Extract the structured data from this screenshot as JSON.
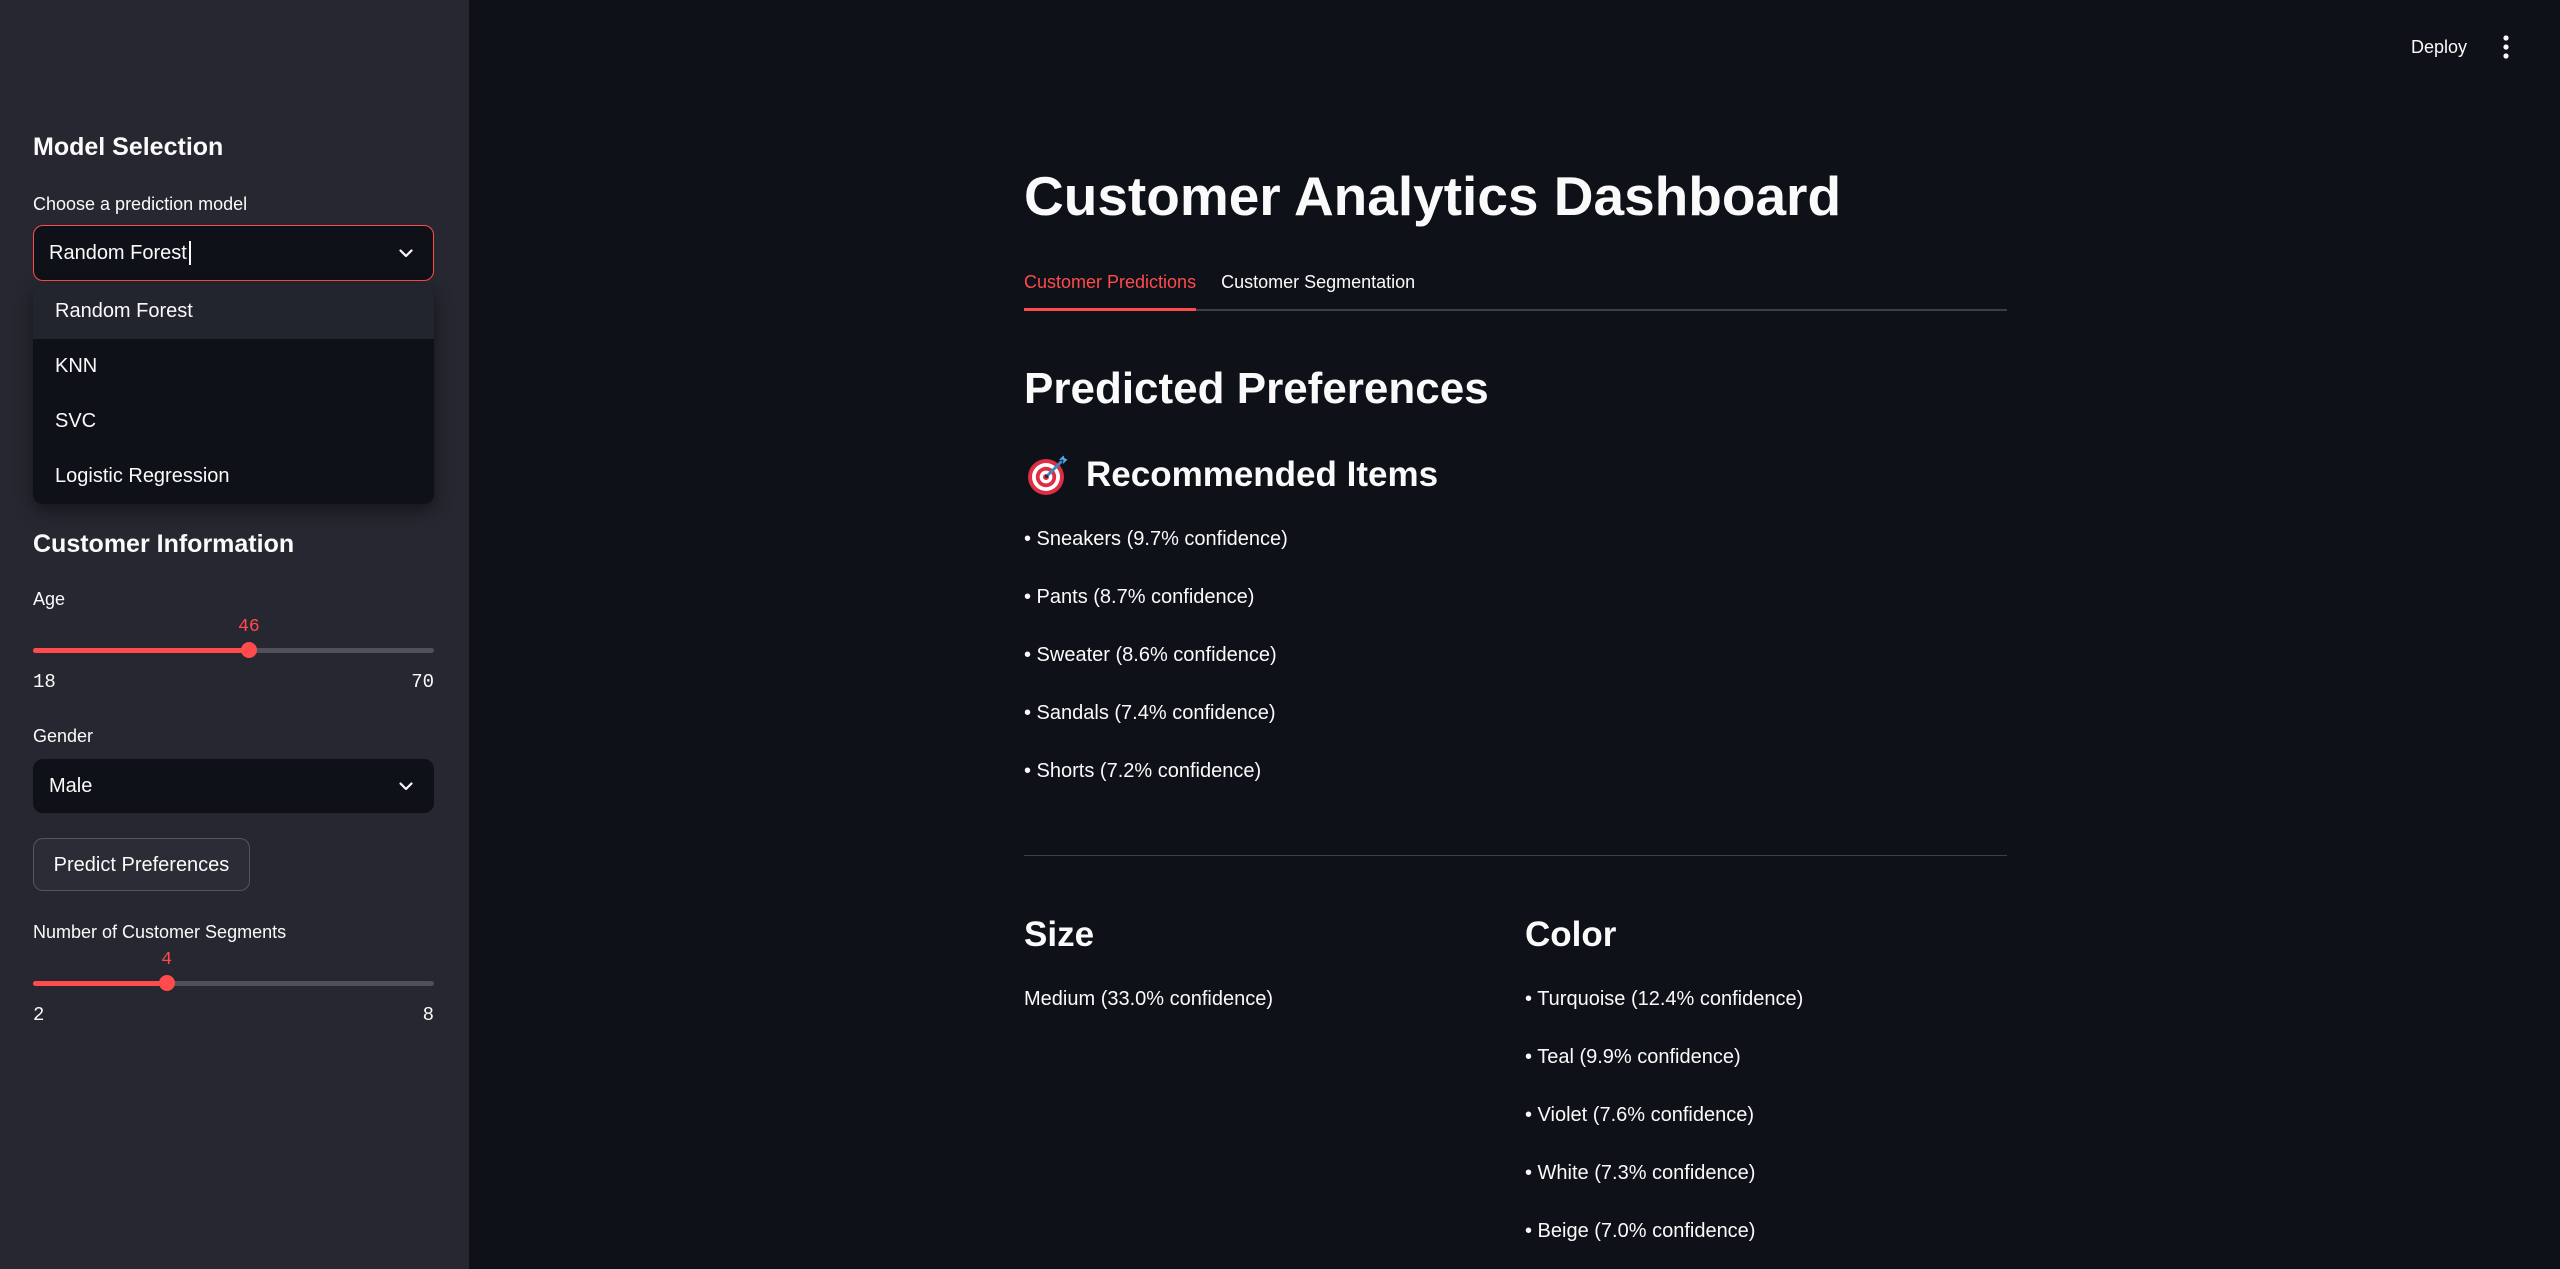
{
  "theme": {
    "accent": "#ff4b4b",
    "background": "#0e1117",
    "sidebar_background": "#262730",
    "text": "#fafafa"
  },
  "header": {
    "deploy_label": "Deploy",
    "menu_icon": "kebab-menu-icon"
  },
  "sidebar": {
    "model_section": {
      "title": "Model Selection",
      "select_label": "Choose a prediction model",
      "selected_value": "Random Forest",
      "focused": true,
      "dropdown_open": true,
      "highlighted_index": 0,
      "options": [
        "Random Forest",
        "KNN",
        "SVC",
        "Logistic Regression"
      ],
      "chevron_icon": "chevron-down-icon"
    },
    "customer_section": {
      "title": "Customer Information",
      "age": {
        "label": "Age",
        "value": 46,
        "min": 18,
        "max": 70
      },
      "gender": {
        "label": "Gender",
        "selected_value": "Male"
      },
      "predict_button_label": "Predict Preferences",
      "segments": {
        "label": "Number of Customer Segments",
        "value": 4,
        "min": 2,
        "max": 8
      }
    }
  },
  "main": {
    "title": "Customer Analytics Dashboard",
    "tabs": [
      {
        "label": "Customer Predictions",
        "active": true
      },
      {
        "label": "Customer Segmentation",
        "active": false
      }
    ],
    "section_title": "Predicted Preferences",
    "recommended": {
      "icon": "direct-hit-icon",
      "title": "Recommended Items",
      "items": [
        "• Sneakers (9.7% confidence)",
        "• Pants (8.7% confidence)",
        "• Sweater (8.6% confidence)",
        "• Sandals (7.4% confidence)",
        "• Shorts (7.2% confidence)"
      ]
    },
    "size": {
      "title": "Size",
      "value": "Medium (33.0% confidence)"
    },
    "color": {
      "title": "Color",
      "items": [
        "• Turquoise (12.4% confidence)",
        "• Teal (9.9% confidence)",
        "• Violet (7.6% confidence)",
        "• White (7.3% confidence)",
        "• Beige (7.0% confidence)"
      ]
    }
  }
}
